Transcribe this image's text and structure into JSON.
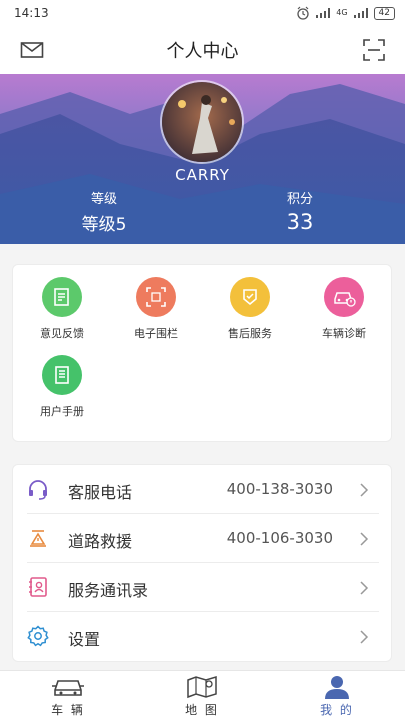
{
  "status_bar": {
    "time": "14:13",
    "network": "4G",
    "battery": "42"
  },
  "header": {
    "title": "个人中心",
    "left_icon": "mail-icon",
    "right_icon": "scan-icon"
  },
  "profile": {
    "username": "CARRY",
    "level_label": "等级",
    "level_value": "等级5",
    "points_label": "积分",
    "points_value": "33"
  },
  "features": [
    {
      "label": "意见反馈",
      "icon": "feedback-icon",
      "color": "#5cc96b"
    },
    {
      "label": "电子围栏",
      "icon": "geofence-icon",
      "color": "#ee7b5e"
    },
    {
      "label": "售后服务",
      "icon": "after-sales-icon",
      "color": "#f3c03b"
    },
    {
      "label": "车辆诊断",
      "icon": "car-diagnosis-icon",
      "color": "#ec5f9b"
    },
    {
      "label": "用户手册",
      "icon": "manual-icon",
      "color": "#45c26a"
    }
  ],
  "menu": [
    {
      "label": "客服电话",
      "value": "400-138-3030",
      "icon": "headset-icon",
      "color": "#7a5cc8"
    },
    {
      "label": "道路救援",
      "value": "400-106-3030",
      "icon": "road-rescue-icon",
      "color": "#e88b3f"
    },
    {
      "label": "服务通讯录",
      "value": "",
      "icon": "contacts-icon",
      "color": "#e15a8c"
    },
    {
      "label": "设置",
      "value": "",
      "icon": "settings-icon",
      "color": "#2f8fd1"
    }
  ],
  "tabs": [
    {
      "label": "车 辆",
      "icon": "car-icon",
      "active": false
    },
    {
      "label": "地 图",
      "icon": "map-icon",
      "active": false
    },
    {
      "label": "我 的",
      "icon": "person-icon",
      "active": true
    }
  ]
}
